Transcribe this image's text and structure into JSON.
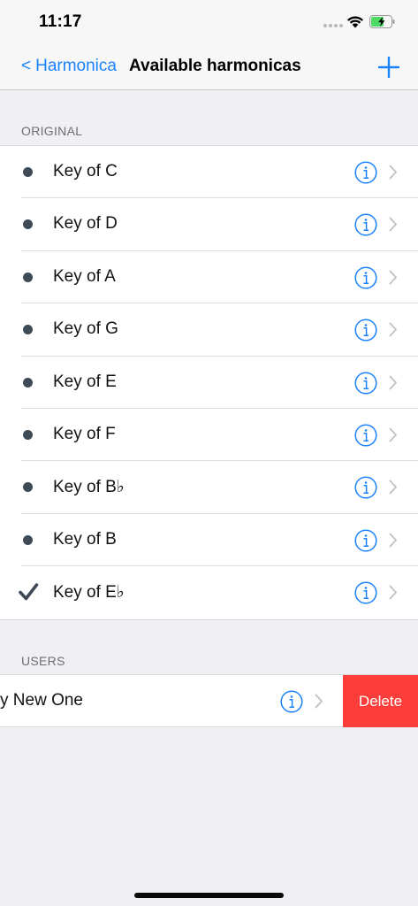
{
  "status_bar": {
    "time": "11:17"
  },
  "nav": {
    "back_label": "Harmonica",
    "back_chevron": "<",
    "title": "Available harmonicas",
    "add_icon": "plus-icon"
  },
  "sections": {
    "original_header": "ORIGINAL",
    "users_header": "USERS"
  },
  "original_items": [
    {
      "label": "Key of C",
      "marker": "bullet"
    },
    {
      "label": "Key of D",
      "marker": "bullet"
    },
    {
      "label": "Key of A",
      "marker": "bullet"
    },
    {
      "label": "Key of G",
      "marker": "bullet"
    },
    {
      "label": "Key of E",
      "marker": "bullet"
    },
    {
      "label": "Key of F",
      "marker": "bullet"
    },
    {
      "label": "Key of B♭",
      "marker": "bullet"
    },
    {
      "label": "Key of B",
      "marker": "bullet"
    },
    {
      "label": "Key of E♭",
      "marker": "checkmark"
    }
  ],
  "user_items": [
    {
      "label": "y New One",
      "action": "Delete"
    }
  ],
  "colors": {
    "accent": "#1a82fb",
    "delete": "#fc3d39",
    "bullet": "#3e4b57",
    "background": "#efeff4"
  }
}
